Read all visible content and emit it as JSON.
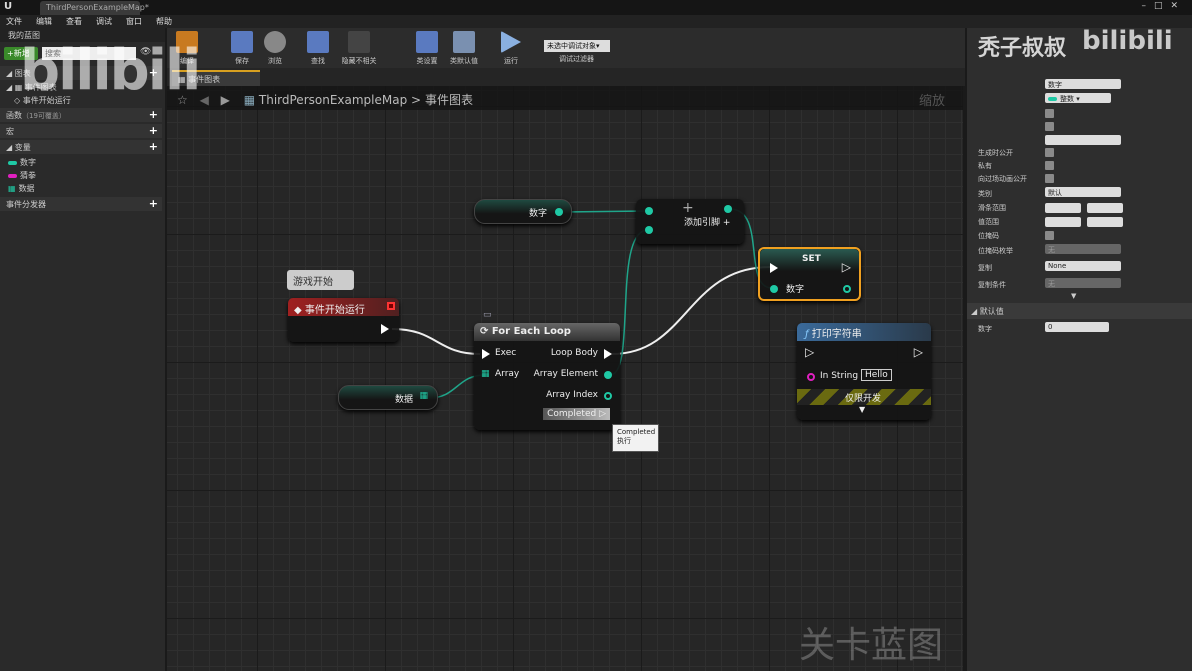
{
  "window": {
    "tab": "ThirdPersonExampleMap*"
  },
  "menu": [
    "文件",
    "编辑",
    "查看",
    "调试",
    "窗口",
    "帮助"
  ],
  "left": {
    "panel_title": "我的蓝图",
    "new_button": "+新增",
    "search_placeholder": "搜索",
    "sections": {
      "graphs": "图表",
      "event_graph": "事件图表",
      "event_begin": "事件开始运行",
      "functions": "函数",
      "functions_note": "（19可覆盖）",
      "macros": "宏",
      "variables": "变量",
      "dispatchers": "事件分发器"
    },
    "variables": [
      {
        "name": "数字",
        "color": "#1fc9a5"
      },
      {
        "name": "猜拳",
        "color": "#e020c0"
      },
      {
        "name": "数据",
        "color": "#1fc9a5"
      }
    ]
  },
  "toolbar": {
    "items": [
      "编译",
      "保存",
      "浏览",
      "查找",
      "隐藏不相关",
      "类设置",
      "类默认值",
      "运行"
    ],
    "debug_select": "未选中调试对象▾",
    "debug_label": "调试过滤器"
  },
  "graph_tab": "事件图表",
  "breadcrumb": {
    "map": "ThirdPersonExampleMap",
    "sep": ">",
    "graph": "事件图表"
  },
  "zoom_label": "缩放",
  "watermark": "关卡蓝图",
  "nodes": {
    "get_number": "数字",
    "add": {
      "plus": "+",
      "label": "添加引脚 +"
    },
    "set": {
      "title": "SET",
      "pin": "数字"
    },
    "comment": "游戏开始",
    "event": "事件开始运行",
    "foreach": {
      "title": "For Each Loop",
      "exec": "Exec",
      "array": "Array",
      "loop_body": "Loop Body",
      "element": "Array Element",
      "index": "Array Index",
      "completed": "Completed"
    },
    "get_data": "数据",
    "print": {
      "title": "打印字符串",
      "in_string": "In String",
      "value": "Hello",
      "dev_only": "仅限开发"
    },
    "tooltip": {
      "line1": "Completed",
      "line2": "执行"
    }
  },
  "right": {
    "name": "数字",
    "type": "整数",
    "labels": [
      "生成时公开",
      "私有",
      "向过场动画公开",
      "类别",
      "滑条范围",
      "值范围",
      "位掩码",
      "位掩码枚举",
      "复制",
      "复制条件"
    ],
    "category": "默认",
    "bitmask_enum": "无",
    "replication": "None",
    "rep_condition": "无",
    "default_section": "默认值",
    "default_label": "数字",
    "default_value": "0"
  },
  "overlay": {
    "uploader": "秃子叔叔",
    "logo": "bilibili"
  }
}
